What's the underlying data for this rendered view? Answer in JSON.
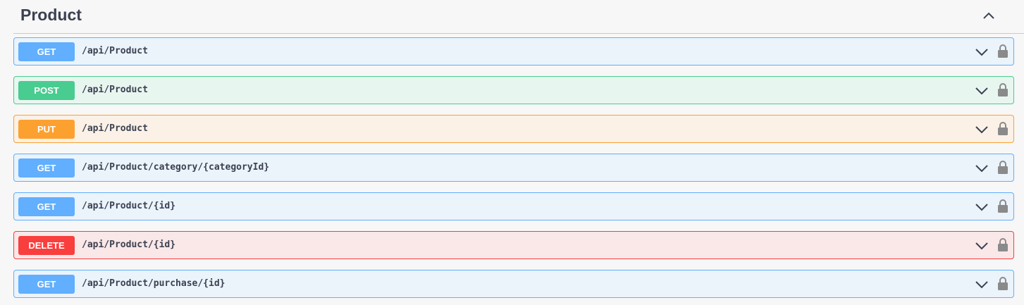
{
  "section": {
    "title": "Product",
    "toggle_icon": "chevron-up-icon"
  },
  "colors": {
    "GET": {
      "badge": "#61affe",
      "bg": "#ebf3fb",
      "border": "#61affe"
    },
    "POST": {
      "badge": "#49cc90",
      "bg": "#e8f6f0",
      "border": "#49cc90"
    },
    "PUT": {
      "badge": "#fca130",
      "bg": "#fbf1e6",
      "border": "#fca130"
    },
    "DELETE": {
      "badge": "#f93e3e",
      "bg": "#fae7e7",
      "border": "#f93e3e"
    }
  },
  "operations": [
    {
      "method": "GET",
      "path": "/api/Product"
    },
    {
      "method": "POST",
      "path": "/api/Product"
    },
    {
      "method": "PUT",
      "path": "/api/Product"
    },
    {
      "method": "GET",
      "path": "/api/Product/category/{categoryId}"
    },
    {
      "method": "GET",
      "path": "/api/Product/{id}"
    },
    {
      "method": "DELETE",
      "path": "/api/Product/{id}"
    },
    {
      "method": "GET",
      "path": "/api/Product/purchase/{id}"
    }
  ],
  "icons": {
    "expand": "chevron-down-icon",
    "auth": "lock-icon"
  }
}
